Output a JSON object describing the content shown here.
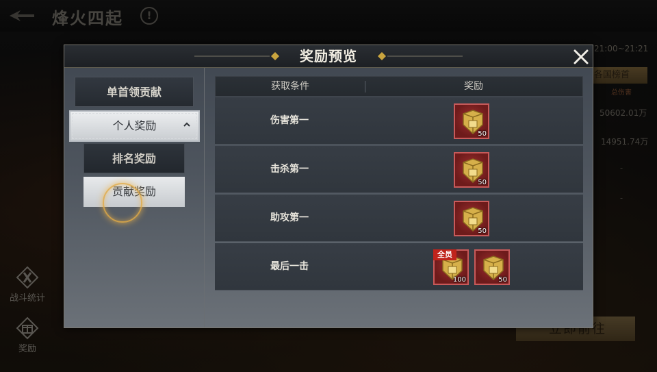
{
  "background": {
    "title": "烽火四起",
    "info_icon": "!",
    "time_range": "21:00~21:21",
    "national_tab": "各国榜首",
    "damage_header": "总伤害",
    "values": [
      "50602.01万",
      "14951.74万",
      "-",
      "-"
    ],
    "side_buttons": [
      {
        "label": "战斗统计",
        "icon": "battle-stats-icon"
      },
      {
        "label": "奖励",
        "icon": "gift-icon"
      }
    ],
    "go_button": "立即前往"
  },
  "dialog": {
    "title": "奖励预览",
    "close_icon": "close-icon",
    "nav": {
      "lead_contrib": "单首领贡献",
      "personal": "个人奖励",
      "rank": "排名奖励",
      "contrib": "贡献奖励"
    },
    "table": {
      "headers": {
        "condition": "获取条件",
        "reward": "奖励"
      },
      "rows": [
        {
          "condition": "伤害第一",
          "rewards": [
            {
              "icon": "gold-shield-chest-icon",
              "qty": "50"
            }
          ]
        },
        {
          "condition": "击杀第一",
          "rewards": [
            {
              "icon": "gold-shield-chest-icon",
              "qty": "50"
            }
          ]
        },
        {
          "condition": "助攻第一",
          "rewards": [
            {
              "icon": "gold-shield-chest-icon",
              "qty": "50"
            }
          ]
        },
        {
          "condition": "最后一击",
          "rewards": [
            {
              "icon": "gold-shield-chest-icon",
              "qty": "100",
              "badge": "全员"
            },
            {
              "icon": "gold-shield-chest-icon",
              "qty": "50"
            }
          ]
        }
      ]
    }
  },
  "colors": {
    "accent_gold": "#c9a43e",
    "item_frame_red": "#8e2424",
    "badge_red": "#c0241c"
  }
}
